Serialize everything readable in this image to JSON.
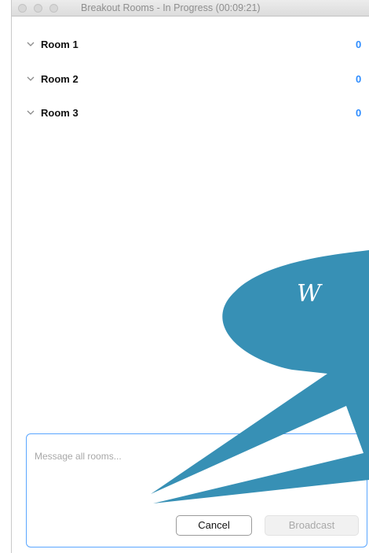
{
  "window": {
    "title": "Breakout Rooms - In Progress (00:09:21)"
  },
  "rooms": [
    {
      "name": "Room 1",
      "count": "0"
    },
    {
      "name": "Room 2",
      "count": "0"
    },
    {
      "name": "Room 3",
      "count": "0"
    }
  ],
  "overlay": {
    "bubble_text": "W",
    "bubble_color": "#3790b5",
    "text_color": "#ffffff"
  },
  "message": {
    "placeholder": "Message all rooms...",
    "cancel_label": "Cancel",
    "broadcast_label": "Broadcast"
  },
  "colors": {
    "accent": "#2d8cff",
    "input_border": "#5aa6ff"
  }
}
